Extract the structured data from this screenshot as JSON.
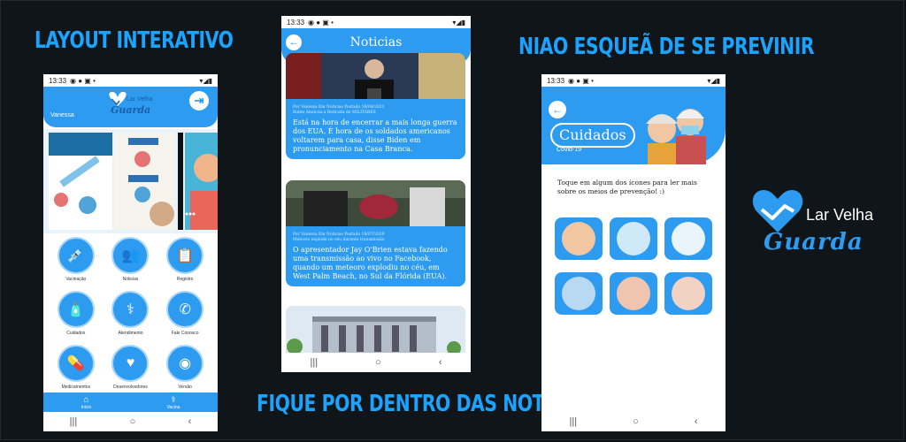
{
  "headlines": {
    "left": "LAYOUT INTERATIVO",
    "middle_bottom": "FIQUE POR DENTRO DAS NOTICIAS",
    "right_top": "NIAO ESQUEÃ DE SE PREVINIR"
  },
  "brand": {
    "line1": "Lar Velha",
    "line2": "Guarda"
  },
  "colors": {
    "accent": "#2c9bf0",
    "background": "#0d1115",
    "headline": "#1aa3ff"
  },
  "phone_home": {
    "time": "13:33",
    "user": "Vanessa",
    "logo_top": "Lar Velha",
    "logo_bottom": "Guarda",
    "tiles": [
      {
        "label": "Vacinação",
        "icon": "syringe-icon"
      },
      {
        "label": "Noticias",
        "icon": "people-icon"
      },
      {
        "label": "Registro",
        "icon": "clipboard-icon"
      },
      {
        "label": "Cuidados",
        "icon": "hand-sanitizer-icon"
      },
      {
        "label": "Atendimento",
        "icon": "doctors-icon"
      },
      {
        "label": "Fale Conosco",
        "icon": "phone-icon"
      },
      {
        "label": "Medicamentos",
        "icon": "pills-icon"
      },
      {
        "label": "Desenvolvedores",
        "icon": "logo-icon"
      },
      {
        "label": "Versão",
        "icon": "cd-icon"
      }
    ],
    "tabs": [
      {
        "label": "Inicio",
        "icon": "home-icon"
      },
      {
        "label": "Vacina",
        "icon": "stethoscope-icon"
      }
    ]
  },
  "phone_news": {
    "time": "13:33",
    "title": "Noticias",
    "articles": [
      {
        "meta1": "Por Vanessa Em Noticias Postado 18/04/2021",
        "meta2": "Biden Anuncia a Retirada de MILITARES",
        "body": "Está na hora de encerrar a mais longa guerra dos EUA. É hora de os soldados americanos voltarem para casa, disse Biden em pronunciamento na Casa Branca."
      },
      {
        "meta1": "Por Vanessa Em Noticias Postado 19/07/2020",
        "meta2": "Meteoro explode no céu durante transmissão",
        "body": "O apresentador Jay O'Brien estava fazendo uma transmissão ao vivo no Facebook, quando um meteoro explodiu no céu, em West Palm Beach, no Sul da Flórida (EUA)."
      }
    ]
  },
  "phone_care": {
    "time": "13:33",
    "title": "Cuidados",
    "subtitle": "Covid-19",
    "instructions": "Toque em algum dos ícones para ler mais sobre os meios de prevenção! :)",
    "icons": [
      "mask-icon",
      "no-touch-face-icon",
      "hand-sanitizer-icon",
      "no-crowd-icon",
      "no-handshake-icon",
      "no-gathering-icon"
    ]
  }
}
